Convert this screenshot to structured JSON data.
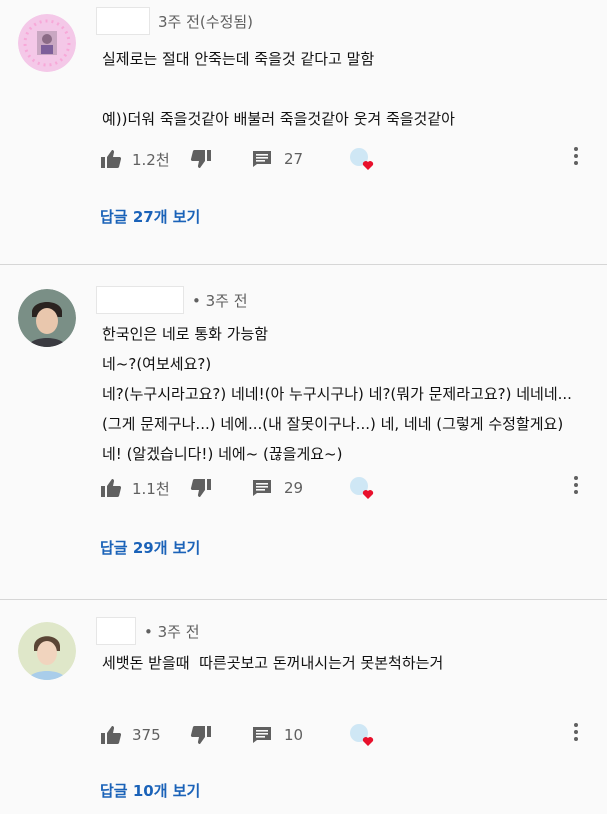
{
  "comments": [
    {
      "time": "3주 전(수정됨)",
      "text": "실제로는 절대 안죽는데 죽을것 같다고 말함\n\n예))더워 죽을것같아 배불러 죽을것같아 웃겨 죽을것같아",
      "likes": "1.2천",
      "replies": "27",
      "view_replies": "답글 27개 보기"
    },
    {
      "time": "• 3주 전",
      "text": "한국인은 네로 통화 가능함\n네~?(여보세요?)\n네?(누구시라고요?) 네네!(아 누구시구나) 네?(뭐가 문제라고요?) 네네네...(그게 문제구나...) 네에...(내 잘못이구나...) 네, 네네 (그렇게 수정할게요) 네! (알겠습니다!) 네에~ (끊을게요~)",
      "likes": "1.1천",
      "replies": "29",
      "view_replies": "답글 29개 보기"
    },
    {
      "time": "• 3주 전",
      "text": "세뱃돈 받을때  따른곳보고 돈꺼내시는거 못본척하는거",
      "likes": "375",
      "replies": "10",
      "view_replies": "답글 10개 보기"
    }
  ],
  "colors": {
    "link": "#1a62b8",
    "heart": "#e8102c",
    "muted": "#606060"
  }
}
